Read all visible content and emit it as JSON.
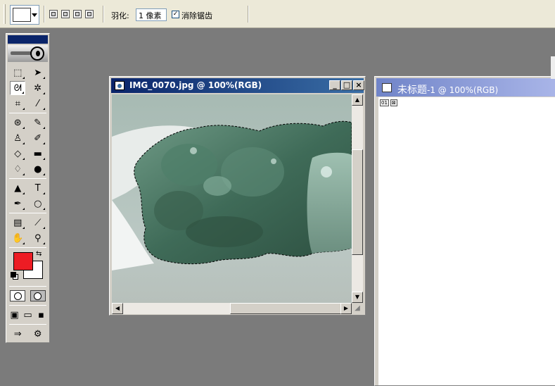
{
  "options_bar": {
    "feather_label": "羽化:",
    "feather_value": "1 像素",
    "antialias_checked": true,
    "antialias_label": "消除锯齿",
    "tool_preset_icon": "lasso-icon",
    "selection_modes": [
      "new-selection-icon",
      "add-to-selection-icon",
      "subtract-from-selection-icon",
      "intersect-selection-icon"
    ]
  },
  "toolbox": {
    "rows": [
      [
        {
          "name": "marquee-tool",
          "glyph": "⬚"
        },
        {
          "name": "move-tool",
          "glyph": "➤"
        }
      ],
      [
        {
          "name": "lasso-tool",
          "glyph": "ᘛ",
          "active": true
        },
        {
          "name": "magic-wand-tool",
          "glyph": "✲"
        }
      ],
      [
        {
          "name": "crop-tool",
          "glyph": "⌗"
        },
        {
          "name": "slice-tool",
          "glyph": "⁄"
        }
      ],
      [
        {
          "name": "healing-brush-tool",
          "glyph": "⊛"
        },
        {
          "name": "brush-tool",
          "glyph": "✎"
        }
      ],
      [
        {
          "name": "clone-stamp-tool",
          "glyph": "♙"
        },
        {
          "name": "history-brush-tool",
          "glyph": "✐"
        }
      ],
      [
        {
          "name": "eraser-tool",
          "glyph": "◇"
        },
        {
          "name": "gradient-tool",
          "glyph": "▬"
        }
      ],
      [
        {
          "name": "blur-tool",
          "glyph": "♢"
        },
        {
          "name": "dodge-tool",
          "glyph": "●"
        }
      ],
      [
        {
          "name": "path-selection-tool",
          "glyph": "▲"
        },
        {
          "name": "type-tool",
          "glyph": "T"
        }
      ],
      [
        {
          "name": "pen-tool",
          "glyph": "✒"
        },
        {
          "name": "shape-tool",
          "glyph": "○"
        }
      ],
      [
        {
          "name": "notes-tool",
          "glyph": "▤"
        },
        {
          "name": "eyedropper-tool",
          "glyph": "⟋"
        }
      ],
      [
        {
          "name": "hand-tool",
          "glyph": "✋"
        },
        {
          "name": "zoom-tool",
          "glyph": "⚲"
        }
      ]
    ],
    "foreground_color": "#ed1c24",
    "background_color": "#ffffff"
  },
  "doc_window": {
    "title": "IMG_0070.jpg @ 100%(RGB)",
    "minimize": "_",
    "maximize": "□",
    "close": "×"
  },
  "doc2_window": {
    "title_main": "未标题",
    "title_rest": "-1 @ 100%(RGB)",
    "tag_1": "01",
    "tag_2": "⊠"
  }
}
